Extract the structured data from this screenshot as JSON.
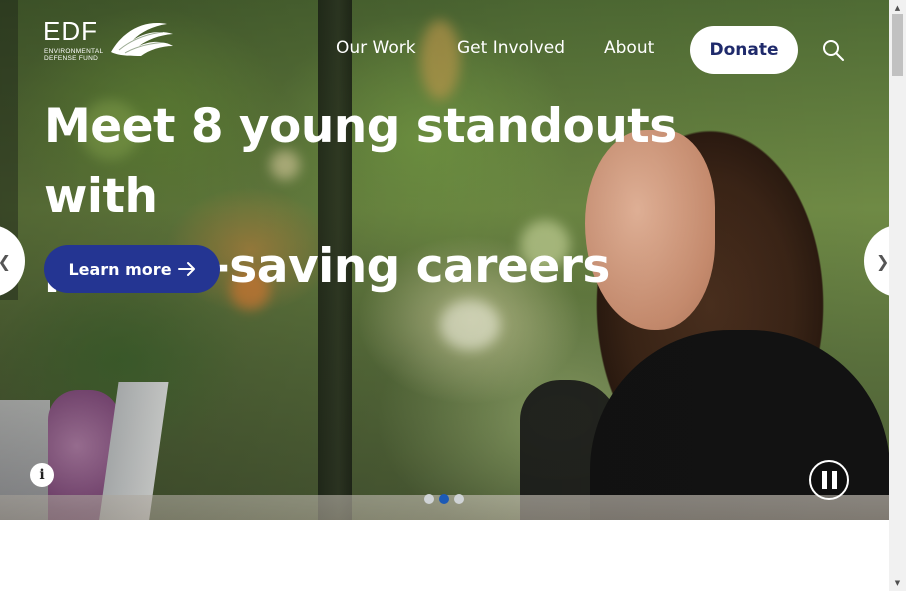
{
  "logo": {
    "mark": "EDF",
    "subtitle_line1": "ENVIRONMENTAL",
    "subtitle_line2": "DEFENSE FUND",
    "icon": "wing-icon"
  },
  "nav": {
    "items": [
      {
        "label": "Our Work"
      },
      {
        "label": "Get Involved"
      },
      {
        "label": "About"
      }
    ],
    "donate_label": "Donate",
    "search_icon": "search-icon"
  },
  "hero": {
    "headline_line1": "Meet 8 young standouts with",
    "headline_line2": "planet-saving careers",
    "cta_label": "Learn more",
    "cta_icon": "arrow-right-icon",
    "prev_glyph": "❮",
    "next_glyph": "❯",
    "info_glyph": "i",
    "slides": [
      {
        "active": false
      },
      {
        "active": true
      },
      {
        "active": false
      }
    ]
  },
  "colors": {
    "primary": "#243592",
    "donate_text": "#1f2a6b",
    "active_dot": "#1c5ab6",
    "inactive_dot": "#cfd3d6"
  },
  "scrollbar": {
    "up_glyph": "▲",
    "down_glyph": "▼"
  }
}
